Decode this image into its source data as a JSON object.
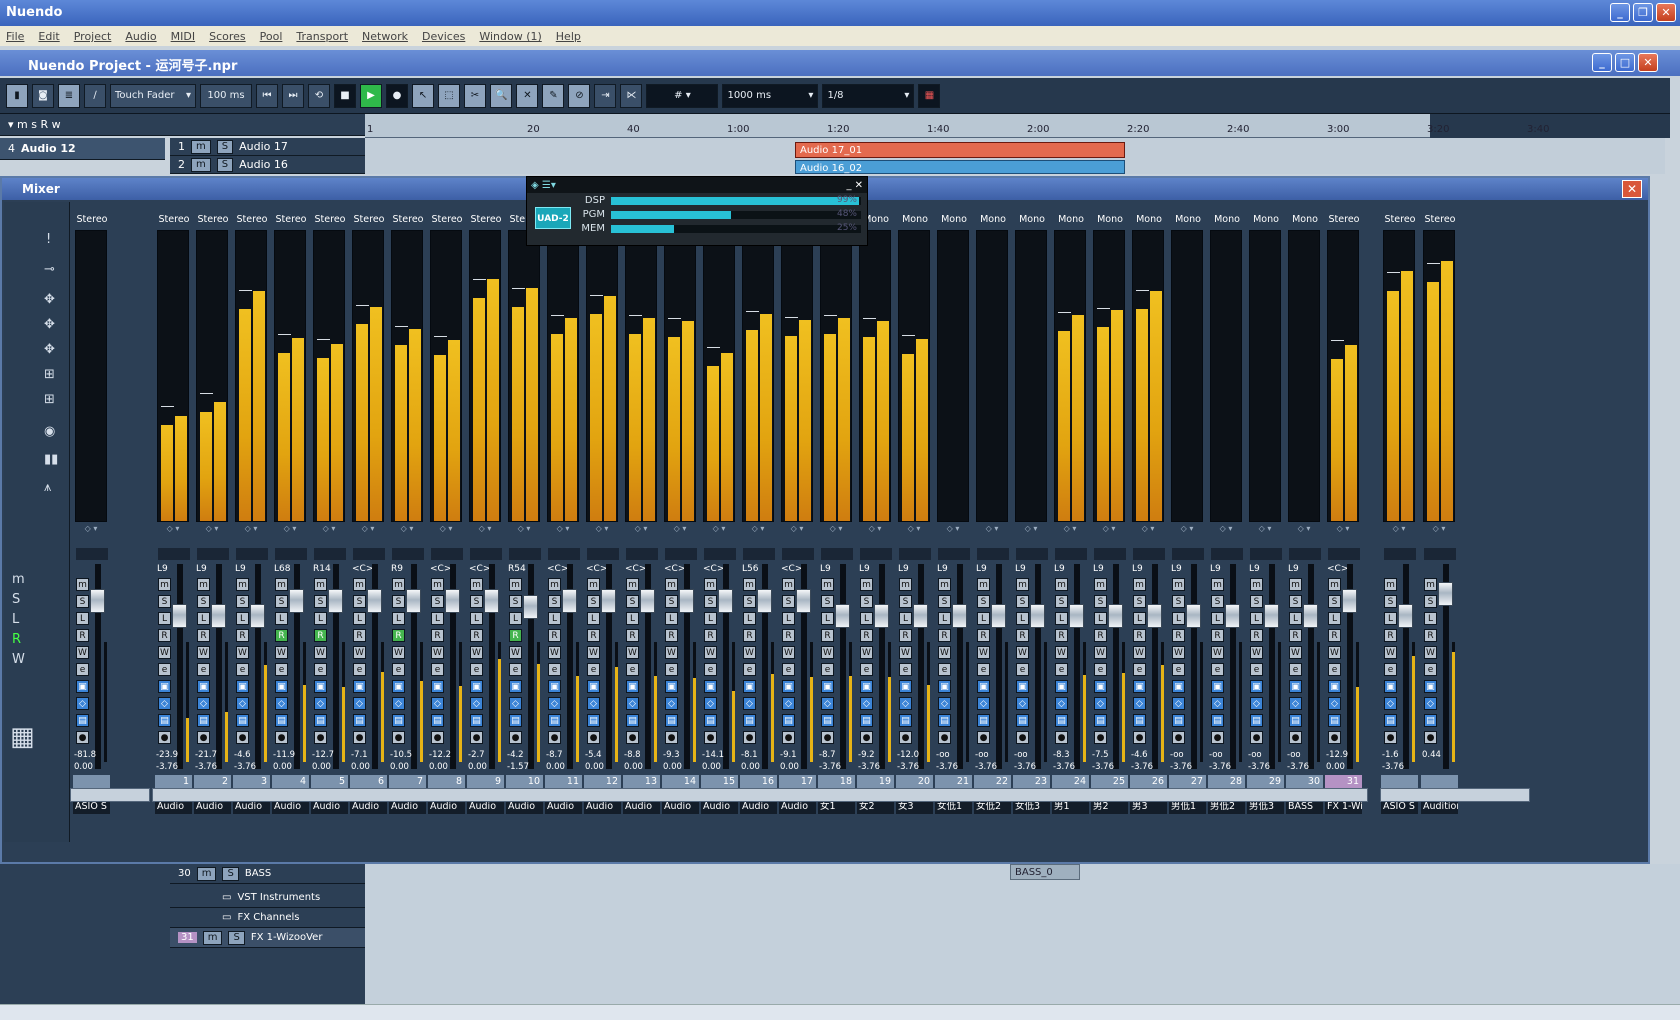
{
  "app": {
    "title": "Nuendo"
  },
  "menu": [
    "File",
    "Edit",
    "Project",
    "Audio",
    "MIDI",
    "Scores",
    "Pool",
    "Transport",
    "Network",
    "Devices",
    "Window (1)",
    "Help"
  ],
  "project": {
    "title": "Nuendo Project - 运河号子.npr"
  },
  "toolbar": {
    "automation_mode": "Touch Fader",
    "time": "100 ms",
    "snap": "1000 ms",
    "quantize": "1/8"
  },
  "ruler": {
    "ticks": [
      "1",
      "20",
      "40",
      "1:00",
      "1:20",
      "1:40",
      "2:00",
      "2:20",
      "2:40",
      "3:00",
      "3:20",
      "3:40"
    ]
  },
  "tracks": {
    "top": [
      {
        "num": "4",
        "name": "Audio 12"
      },
      {
        "num": "1",
        "name": "Audio 17"
      },
      {
        "num": "2",
        "name": "Audio 16"
      }
    ],
    "clips": [
      {
        "name": "Audio 17_01",
        "color": "#e36a4e"
      },
      {
        "name": "Audio 16_02",
        "color": "#4b9ed6"
      }
    ],
    "bottom": [
      {
        "num": "30",
        "name": "BASS"
      },
      {
        "num": "",
        "name": "VST Instruments"
      },
      {
        "num": "",
        "name": "FX Channels"
      },
      {
        "num": "31",
        "name": "FX 1-WizooVer"
      }
    ],
    "bass_clip": "BASS_0"
  },
  "mixer": {
    "title": "Mixer",
    "input": {
      "label": "Stereo",
      "name": "ASIO S",
      "v1": "-81.8",
      "v2": "0.00"
    },
    "strips": [
      {
        "label": "Stereo",
        "ch": "L9",
        "v1": "-23.9",
        "v2": "-3.76",
        "num": "1",
        "name": "Audio",
        "rec": false
      },
      {
        "label": "Stereo",
        "ch": "L9",
        "v1": "-21.7",
        "v2": "-3.76",
        "num": "2",
        "name": "Audio",
        "rec": false
      },
      {
        "label": "Stereo",
        "ch": "L9",
        "v1": "-4.6",
        "v2": "-3.76",
        "num": "3",
        "name": "Audio",
        "rec": false
      },
      {
        "label": "Stereo",
        "ch": "L68",
        "v1": "-11.9",
        "v2": "0.00",
        "num": "4",
        "name": "Audio",
        "rec": true
      },
      {
        "label": "Stereo",
        "ch": "R14",
        "v1": "-12.7",
        "v2": "0.00",
        "num": "5",
        "name": "Audio",
        "rec": true
      },
      {
        "label": "Stereo",
        "ch": "<C>",
        "v1": "-7.1",
        "v2": "0.00",
        "num": "6",
        "name": "Audio",
        "rec": false
      },
      {
        "label": "Stereo",
        "ch": "R9",
        "v1": "-10.5",
        "v2": "0.00",
        "num": "7",
        "name": "Audio",
        "rec": true
      },
      {
        "label": "Stereo",
        "ch": "<C>",
        "v1": "-12.2",
        "v2": "0.00",
        "num": "8",
        "name": "Audio",
        "rec": false
      },
      {
        "label": "Stereo",
        "ch": "<C>",
        "v1": "-2.7",
        "v2": "0.00",
        "num": "9",
        "name": "Audio",
        "rec": false
      },
      {
        "label": "Stereo",
        "ch": "R54",
        "v1": "-4.2",
        "v2": "-1.57",
        "num": "10",
        "name": "Audio",
        "rec": true
      },
      {
        "label": "Stereo",
        "ch": "<C>",
        "v1": "-8.7",
        "v2": "0.00",
        "num": "11",
        "name": "Audio",
        "rec": false
      },
      {
        "label": "Stereo",
        "ch": "<C>",
        "v1": "-5.4",
        "v2": "0.00",
        "num": "12",
        "name": "Audio",
        "rec": false
      },
      {
        "label": "Stereo",
        "ch": "<C>",
        "v1": "-8.8",
        "v2": "0.00",
        "num": "13",
        "name": "Audio",
        "rec": false
      },
      {
        "label": "Stereo",
        "ch": "<C>",
        "v1": "-9.3",
        "v2": "0.00",
        "num": "14",
        "name": "Audio",
        "rec": false
      },
      {
        "label": "Stereo",
        "ch": "<C>",
        "v1": "-14.1",
        "v2": "0.00",
        "num": "15",
        "name": "Audio",
        "rec": false
      },
      {
        "label": "Stereo",
        "ch": "L56",
        "v1": "-8.1",
        "v2": "0.00",
        "num": "16",
        "name": "Audio",
        "rec": false
      },
      {
        "label": "Stereo",
        "ch": "<C>",
        "v1": "-9.1",
        "v2": "0.00",
        "num": "17",
        "name": "Audio",
        "rec": false
      },
      {
        "label": "Mono",
        "ch": "L9",
        "v1": "-8.7",
        "v2": "-3.76",
        "num": "18",
        "name": "女1",
        "rec": false
      },
      {
        "label": "Mono",
        "ch": "L9",
        "v1": "-9.2",
        "v2": "-3.76",
        "num": "19",
        "name": "女2",
        "rec": false
      },
      {
        "label": "Mono",
        "ch": "L9",
        "v1": "-12.0",
        "v2": "-3.76",
        "num": "20",
        "name": "女3",
        "rec": false
      },
      {
        "label": "Mono",
        "ch": "L9",
        "v1": "-oo",
        "v2": "-3.76",
        "num": "21",
        "name": "女低1",
        "rec": false
      },
      {
        "label": "Mono",
        "ch": "L9",
        "v1": "-oo",
        "v2": "-3.76",
        "num": "22",
        "name": "女低2",
        "rec": false
      },
      {
        "label": "Mono",
        "ch": "L9",
        "v1": "-oo",
        "v2": "-3.76",
        "num": "23",
        "name": "女低3",
        "rec": false
      },
      {
        "label": "Mono",
        "ch": "L9",
        "v1": "-8.3",
        "v2": "-3.76",
        "num": "24",
        "name": "男1",
        "rec": false
      },
      {
        "label": "Mono",
        "ch": "L9",
        "v1": "-7.5",
        "v2": "-3.76",
        "num": "25",
        "name": "男2",
        "rec": false
      },
      {
        "label": "Mono",
        "ch": "L9",
        "v1": "-4.6",
        "v2": "-3.76",
        "num": "26",
        "name": "男3",
        "rec": false
      },
      {
        "label": "Mono",
        "ch": "L9",
        "v1": "-oo",
        "v2": "-3.76",
        "num": "27",
        "name": "男低1",
        "rec": false
      },
      {
        "label": "Mono",
        "ch": "L9",
        "v1": "-oo",
        "v2": "-3.76",
        "num": "28",
        "name": "男低2",
        "rec": false
      },
      {
        "label": "Mono",
        "ch": "L9",
        "v1": "-oo",
        "v2": "-3.76",
        "num": "29",
        "name": "男低3",
        "rec": false
      },
      {
        "label": "Mono",
        "ch": "L9",
        "v1": "-oo",
        "v2": "-3.76",
        "num": "30",
        "name": "BASS",
        "rec": false
      },
      {
        "label": "Stereo",
        "ch": "<C>",
        "v1": "-12.9",
        "v2": "0.00",
        "num": "31",
        "name": "FX 1-Wi",
        "rec": false
      }
    ],
    "out1": {
      "label": "Stereo",
      "name": "ASIO S",
      "v1": "-1.6",
      "v2": "-3.76"
    },
    "out2": {
      "label": "Stereo",
      "name": "Audition",
      "v1": "0.44"
    }
  },
  "uad": {
    "logo": "UAD-2",
    "dsp": {
      "label": "DSP",
      "pct": 99
    },
    "pgm": {
      "label": "PGM",
      "pct": 48
    },
    "mem": {
      "label": "MEM",
      "pct": 25
    }
  }
}
